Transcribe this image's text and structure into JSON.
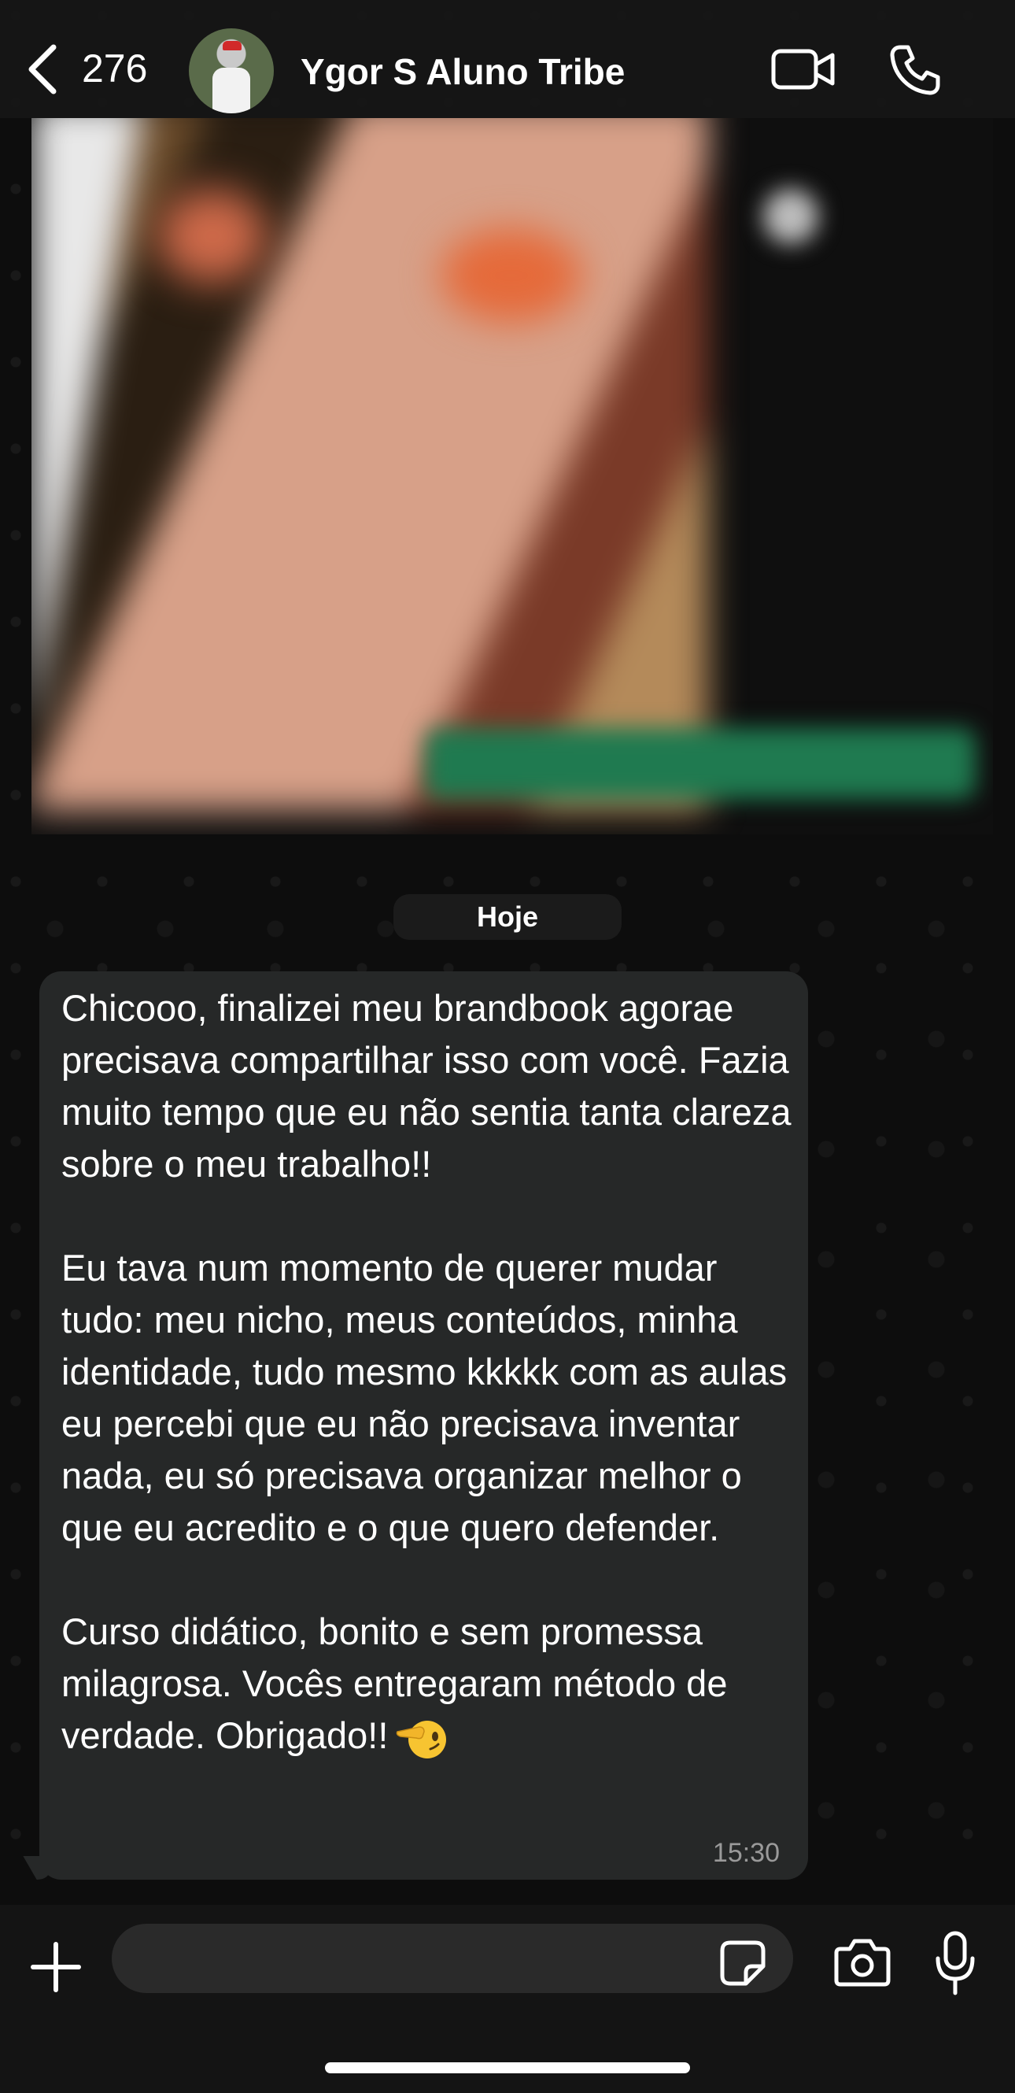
{
  "header": {
    "back_count": "276",
    "contact_name": "Ygor S Aluno Tribe"
  },
  "chat": {
    "date_label": "Hoje",
    "message": {
      "paragraphs": [
        "Chicooo, finalizei meu brandbook agorae precisava compartilhar isso com você. Fazia muito tempo que eu não sentia tanta clareza sobre o meu trabalho!!",
        "Eu tava num momento de querer mudar tudo: meu nicho, meus conteúdos, minha identidade, tudo mesmo kkkkk com as aulas eu percebi que eu não precisava inventar nada, eu só precisava organizar melhor o que eu acredito e o que quero defender.",
        "Curso didático, bonito e sem promessa milagrosa. Vocês entregaram método de verdade. Obrigado!!"
      ],
      "emoji": "saluting-face",
      "time": "15:30"
    }
  },
  "input": {
    "placeholder": ""
  },
  "icons": {
    "back": "chevron-left-icon",
    "video": "video-call-icon",
    "phone": "phone-icon",
    "plus": "plus-icon",
    "sticker": "sticker-icon",
    "camera": "camera-icon",
    "mic": "microphone-icon"
  }
}
